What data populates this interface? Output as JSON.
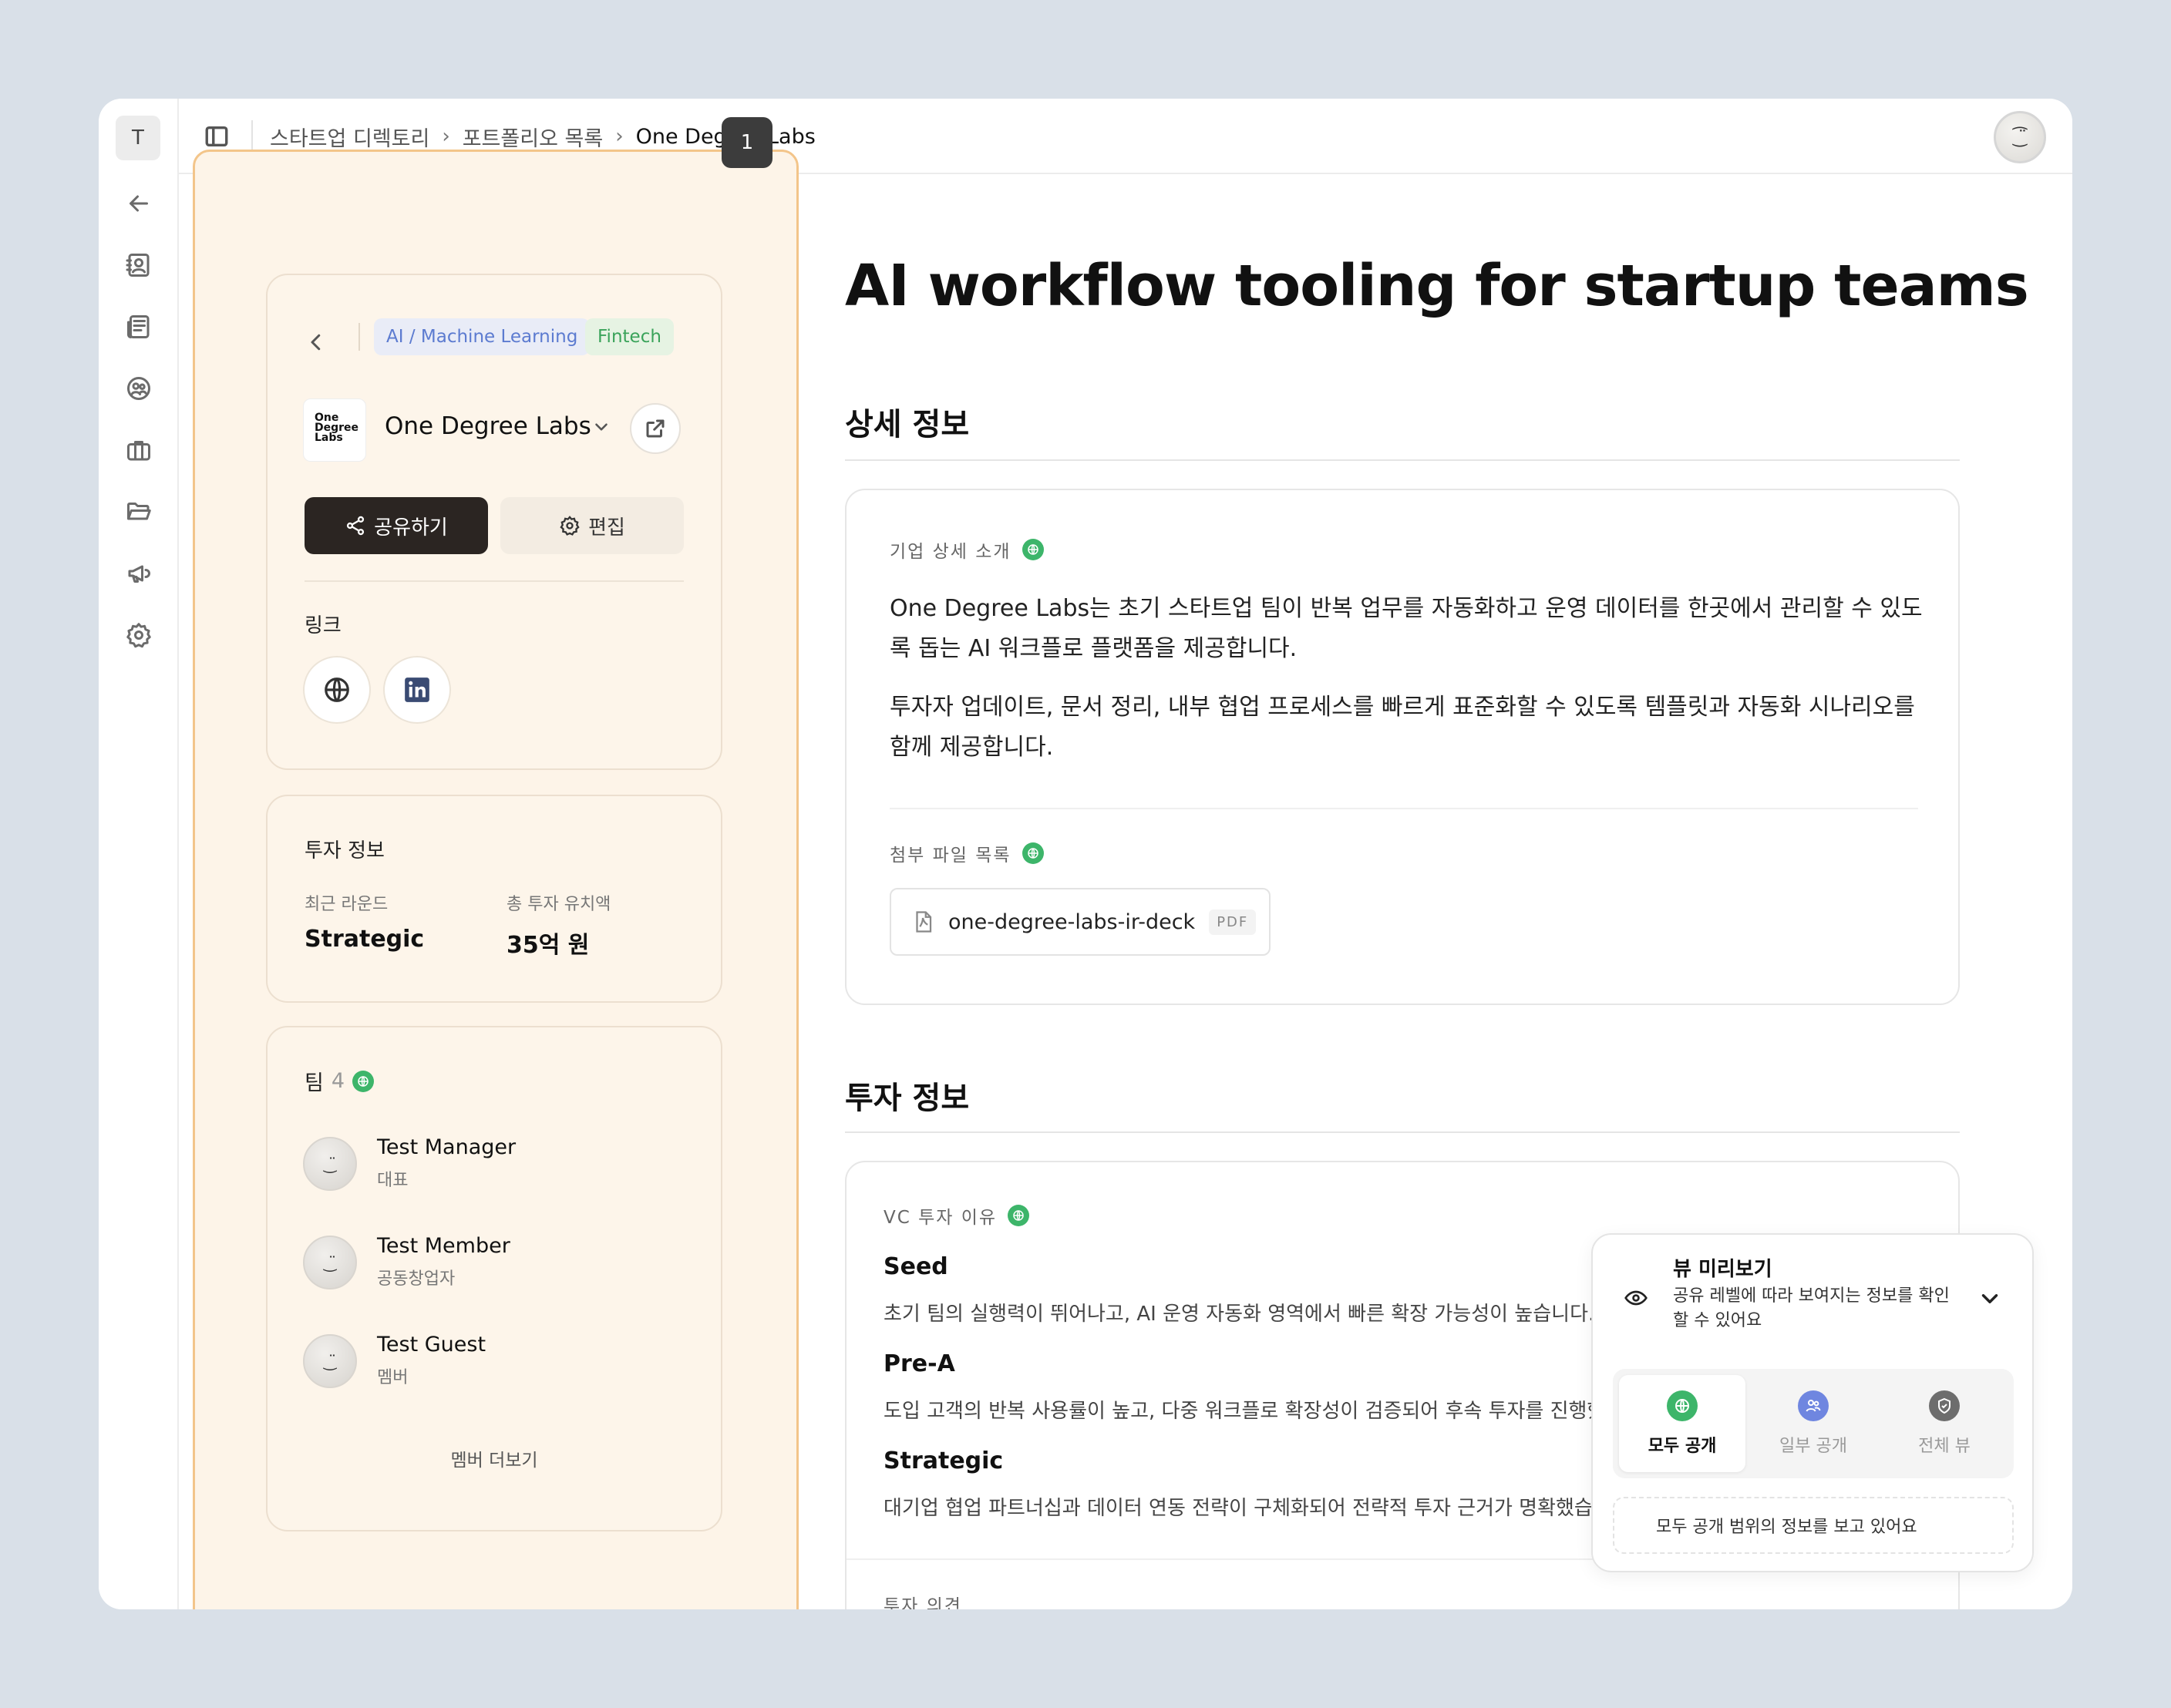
{
  "rail": {
    "workspace_initial": "T",
    "icons": [
      "arrow-left-icon",
      "contacts-icon",
      "news-icon",
      "people-circle-icon",
      "briefcase-icon",
      "folder-icon",
      "megaphone-icon",
      "settings-icon"
    ]
  },
  "breadcrumb": {
    "items": [
      "스타트업 디렉토리",
      "포트폴리오 목록",
      "One Degree Labs"
    ]
  },
  "step_badge": "1",
  "user_avatar_face": "⁐̈",
  "company": {
    "tags": [
      "AI / Machine Learning",
      "Fintech"
    ],
    "logo_lines": [
      "One",
      "Degree",
      "Labs"
    ],
    "name": "One Degree Labs",
    "share_label": "공유하기",
    "edit_label": "편집",
    "links_label": "링크"
  },
  "investment_summary": {
    "title": "투자 정보",
    "recent_round_label": "최근 라운드",
    "recent_round_value": "Strategic",
    "total_raised_label": "총 투자 유치액",
    "total_raised_value": "35억 원"
  },
  "team": {
    "title": "팀",
    "count": "4",
    "members": [
      {
        "name": "Test Manager",
        "role": "대표"
      },
      {
        "name": "Test Member",
        "role": "공동창업자"
      },
      {
        "name": "Test Guest",
        "role": "멤버"
      }
    ],
    "more_label": "멤버 더보기"
  },
  "main": {
    "title": "AI workflow tooling for startup teams",
    "detail_heading": "상세 정보",
    "detail_intro_label": "기업 상세 소개",
    "detail_paragraph_1_line_1": "One Degree Labs는 초기 스타트업 팀이 반복 업무를 자동화하고 운영 데이터를 한곳에서 관리할 수 있도",
    "detail_paragraph_1_line_2": "록 돕는 AI 워크플로 플랫폼을 제공합니다.",
    "detail_paragraph_2_line_1": "투자자 업데이트, 문서 정리, 내부 협업 프로세스를 빠르게 표준화할 수 있도록 템플릿과 자동화 시나리오를",
    "detail_paragraph_2_line_2": "함께 제공합니다.",
    "attachments_label": "첨부 파일 목록",
    "file_name": "one-degree-labs-ir-deck",
    "file_type": "PDF",
    "investment_heading": "투자 정보",
    "vc_reason_label": "VC 투자 이유",
    "rounds": [
      {
        "name": "Seed",
        "desc": "초기 팀의 실행력이 뛰어나고, AI 운영 자동화 영역에서 빠른 확장 가능성이 높습니다."
      },
      {
        "name": "Pre-A",
        "desc": "도입 고객의 반복 사용률이 높고, 다중 워크플로 확장성이 검증되어 후속 투자를 진행했"
      },
      {
        "name": "Strategic",
        "desc": "대기업 협업 파트너십과 데이터 연동 전략이 구체화되어 전략적 투자 근거가 명확했습"
      }
    ],
    "cutoff_label": "투자 의견"
  },
  "preview": {
    "title": "뷰 미리보기",
    "subtitle": "공유 레벨에 따라 보여지는 정보를 확인할 수 있어요",
    "tabs": [
      {
        "label": "모두 공개",
        "color": "#3db56a",
        "active": true
      },
      {
        "label": "일부 공개",
        "color": "#6f86e0",
        "active": false
      },
      {
        "label": "전체 뷰",
        "color": "#6d6d6d",
        "active": false
      }
    ],
    "note": "모두 공개 범위의 정보를 보고 있어요"
  },
  "colors": {
    "accent_dark": "#2b2522",
    "highlight_border": "#f3c58a",
    "public_green": "#3db56a",
    "partial_blue": "#6f86e0"
  }
}
